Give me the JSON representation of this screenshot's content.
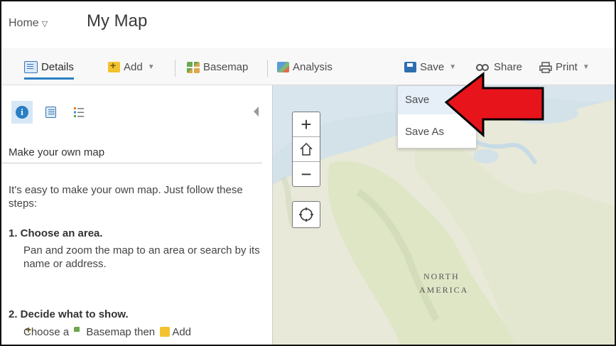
{
  "header": {
    "home_label": "Home",
    "map_title": "My Map"
  },
  "toolbar": {
    "details": "Details",
    "add": "Add",
    "basemap": "Basemap",
    "analysis": "Analysis",
    "save": "Save",
    "share": "Share",
    "print": "Print"
  },
  "save_menu": {
    "items": [
      "Save",
      "Save As"
    ],
    "highlighted": "Save"
  },
  "panel": {
    "title": "Make your own map",
    "intro": "It's easy to make your own map. Just follow these steps:",
    "step1_title": "1. Choose an area.",
    "step1_body": "Pan and zoom the map to an area or search by its name or address.",
    "step2_title": "2. Decide what to show.",
    "step2_pre": "Choose a",
    "step2_basemap": "Basemap",
    "step2_mid": "then",
    "step2_add": "Add"
  },
  "map": {
    "label_line1": "NORTH",
    "label_line2": "AMERICA"
  },
  "colors": {
    "accent": "#2a7fc4",
    "arrow": "#e8141b",
    "water": "#d7e3ea",
    "land": "#e6e8d4"
  }
}
